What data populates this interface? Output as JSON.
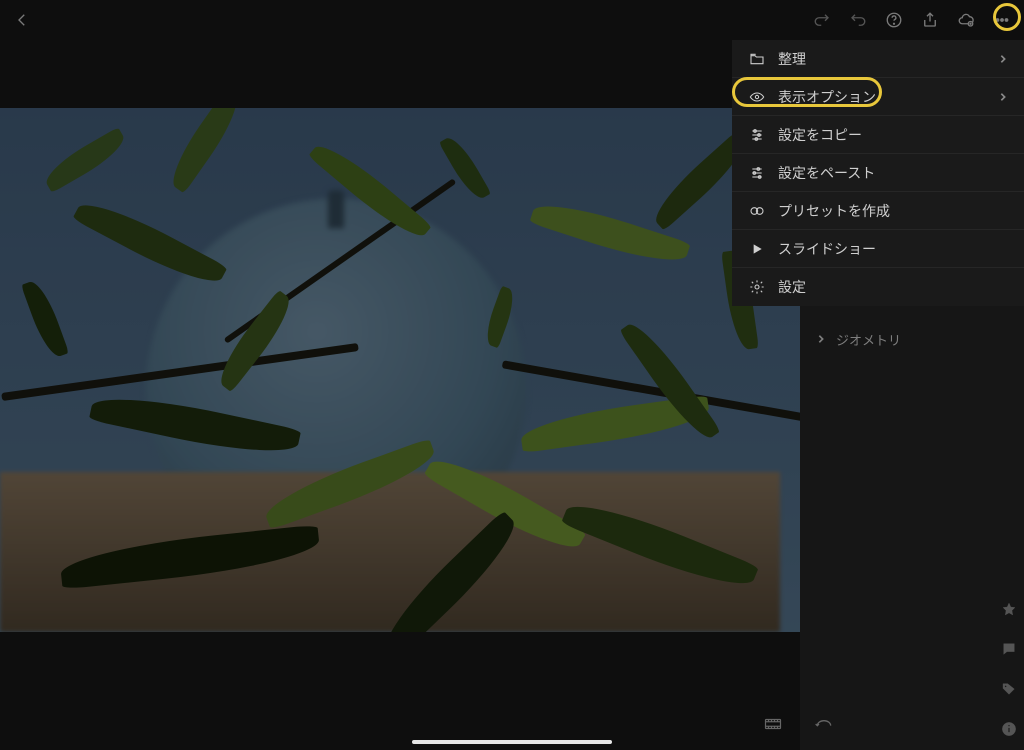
{
  "menu": {
    "items": [
      {
        "label": "整理",
        "has_chevron": true
      },
      {
        "label": "表示オプション",
        "has_chevron": true
      },
      {
        "label": "設定をコピー",
        "has_chevron": false
      },
      {
        "label": "設定をペースト",
        "has_chevron": false
      },
      {
        "label": "プリセットを作成",
        "has_chevron": false
      },
      {
        "label": "スライドショー",
        "has_chevron": false
      },
      {
        "label": "設定",
        "has_chevron": false
      }
    ]
  },
  "sidebar": {
    "geometry_label": "ジオメトリ"
  }
}
